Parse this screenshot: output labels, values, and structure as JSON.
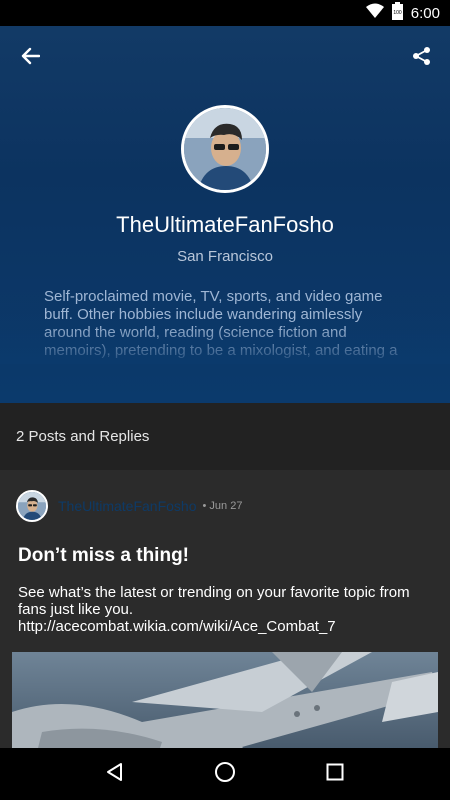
{
  "status_bar": {
    "time": "6:00",
    "battery_level": "100",
    "icons": [
      "wifi-icon",
      "battery-icon"
    ]
  },
  "header": {
    "username": "TheUltimateFanFosho",
    "location": "San Francisco",
    "bio": "Self-proclaimed movie, TV, sports, and video game buff. Other hobbies include wandering aimlessly around the world, reading (science fiction and memoirs), pretending to be a mixologist, and eating a",
    "icons": [
      "back-arrow-icon",
      "share-icon"
    ]
  },
  "posts_section": {
    "label": "2 Posts and Replies"
  },
  "post": {
    "author": "TheUltimateFanFosho",
    "date": "• Jun 27",
    "title": "Don’t miss a thing!",
    "body": "See what’s the latest or trending on your favorite topic from fans just like you. http://acecombat.wikia.com/wiki/Ace_Combat_7"
  },
  "nav_bar": {
    "icons": [
      "back-triangle-icon",
      "home-circle-icon",
      "recents-square-icon"
    ]
  },
  "colors": {
    "header_bg": "#0c3360",
    "posts_bar_bg": "#222222",
    "card_bg": "#2b2b2b",
    "author_link": "#0e3a66"
  }
}
